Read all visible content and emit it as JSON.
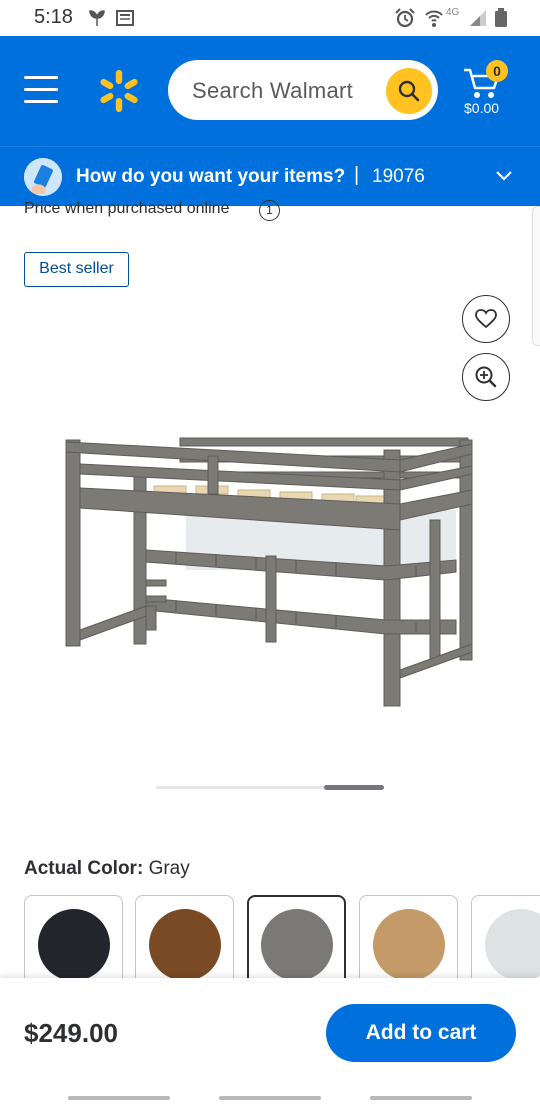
{
  "status_bar": {
    "time": "5:18",
    "network": "4G"
  },
  "header": {
    "search_placeholder": "Search Walmart",
    "cart_count": "0",
    "cart_total": "$0.00"
  },
  "delivery": {
    "question": "How do you want your items?",
    "separator": "|",
    "zip": "19076"
  },
  "product": {
    "price_note": "Price when purchased online",
    "info_glyph": "1",
    "badge": "Best seller",
    "color_label": "Actual Color:",
    "color_value": "Gray",
    "carousel_position": 0.72,
    "swatches": [
      {
        "name": "Black",
        "color": "#22252c"
      },
      {
        "name": "Brown",
        "color": "#7a4a25"
      },
      {
        "name": "Gray",
        "color": "#7a7975"
      },
      {
        "name": "Natural",
        "color": "#c49a68"
      },
      {
        "name": "White",
        "color": "#dde3e2"
      }
    ],
    "selected_swatch": 2
  },
  "bottom": {
    "price": "$249.00",
    "add_to_cart": "Add to cart"
  },
  "colors": {
    "brand_blue": "#0071dc",
    "brand_yellow": "#ffc220"
  }
}
